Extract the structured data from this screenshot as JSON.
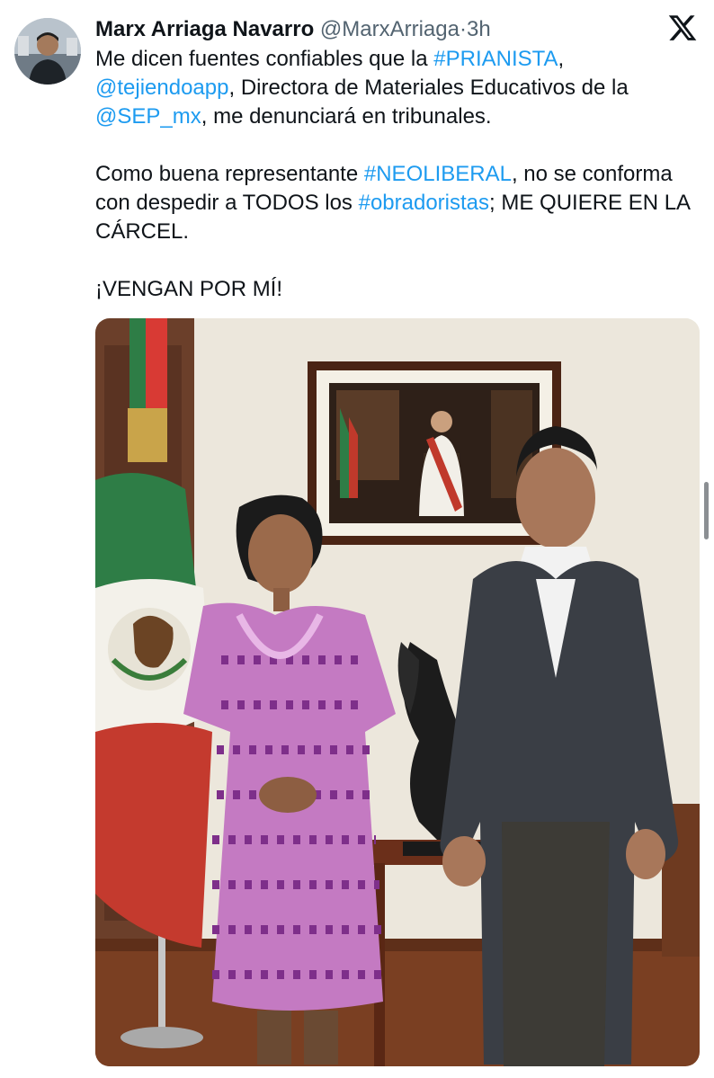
{
  "tweet": {
    "author_name": "Marx Arriaga Navarro",
    "handle": "@MarxArriaga",
    "separator": "·",
    "time": "3h",
    "paragraphs": [
      {
        "p1_a": "Me dicen fuentes confiables que la ",
        "p1_tag_prianista": "#PRIANISTA",
        "p1_b": ",",
        "p1_mention_tejiendo": "@tejiendoapp",
        "p1_c": ", Directora de Materiales Educativos de la ",
        "p1_mention_sep": "@SEP_mx",
        "p1_d": ", me denunciará en tribunales."
      }
    ],
    "p2_a": "Como buena representante ",
    "p2_tag_neoliberal": "#NEOLIBERAL",
    "p2_b": ", no se conforma con despedir a TODOS los ",
    "p2_tag_obradoristas": "#obradoristas",
    "p2_c": "; ME QUIERE EN LA CÁRCEL.",
    "p3": "¡VENGAN POR MÍ!"
  },
  "colors": {
    "link": "#1d9bf0",
    "text": "#0f1419",
    "secondary": "#536471"
  },
  "icons": {
    "brand": "x-logo-icon"
  }
}
